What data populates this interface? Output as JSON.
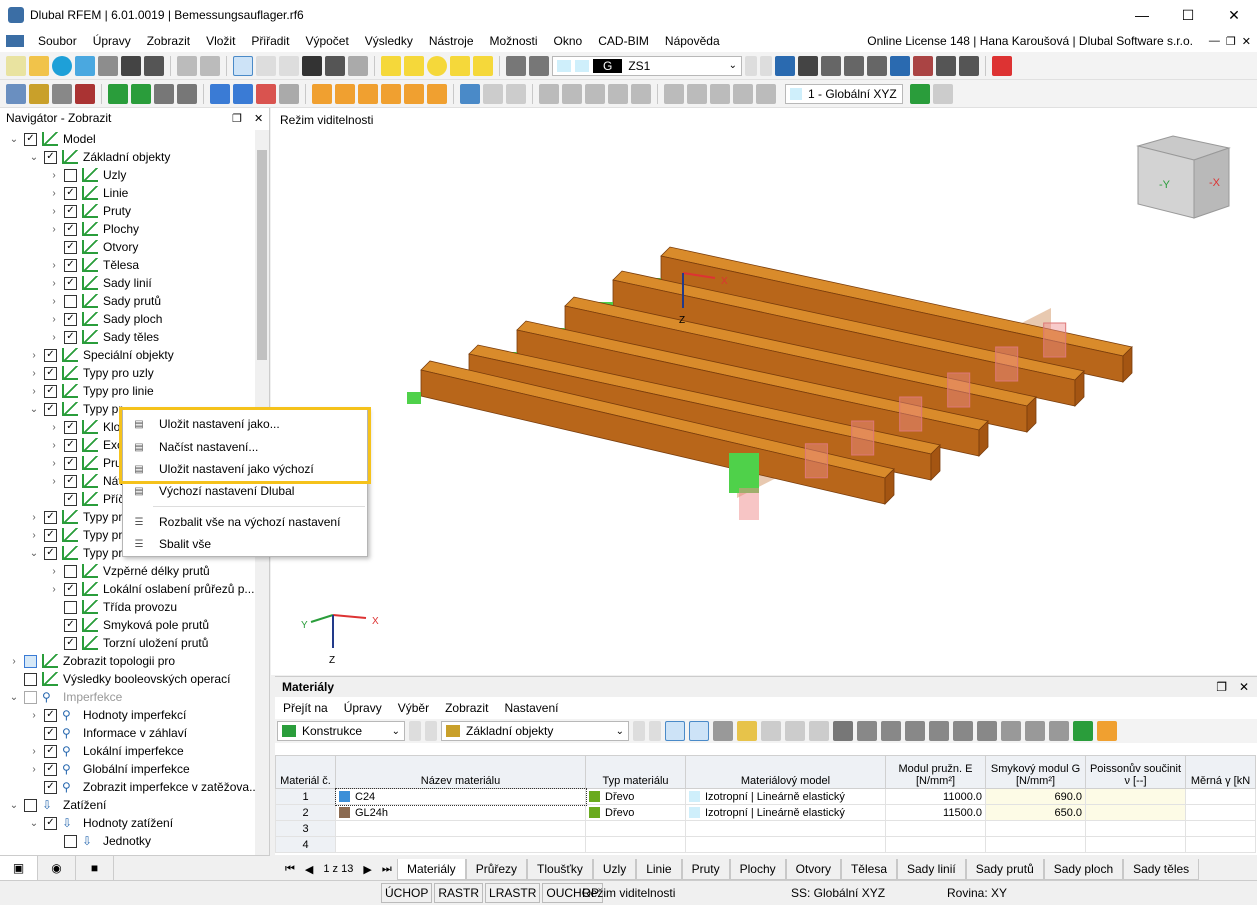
{
  "window": {
    "title": "Dlubal RFEM | 6.01.0019 | Bemessungsauflager.rf6",
    "minimize": "—",
    "maximize": "☐",
    "close": "✕"
  },
  "menu": {
    "items": [
      "Soubor",
      "Úpravy",
      "Zobrazit",
      "Vložit",
      "Přiřadit",
      "Výpočet",
      "Výsledky",
      "Nástroje",
      "Možnosti",
      "Okno",
      "CAD-BIM",
      "Nápověda"
    ],
    "license": "Online License 148 | Hana Karoušová | Dlubal Software s.r.o."
  },
  "toolbar": {
    "loadcase_code": "G",
    "loadcase": "ZS1",
    "coord_system": "1 - Globální XYZ"
  },
  "navigator": {
    "title": "Navigátor - Zobrazit",
    "items": [
      {
        "label": "Model",
        "level": 0,
        "exp": "⌄",
        "checked": true
      },
      {
        "label": "Základní objekty",
        "level": 1,
        "exp": "⌄",
        "checked": true
      },
      {
        "label": "Uzly",
        "level": 2,
        "exp": "›",
        "checked": false
      },
      {
        "label": "Linie",
        "level": 2,
        "exp": "›",
        "checked": true
      },
      {
        "label": "Pruty",
        "level": 2,
        "exp": "›",
        "checked": true
      },
      {
        "label": "Plochy",
        "level": 2,
        "exp": "›",
        "checked": true
      },
      {
        "label": "Otvory",
        "level": 2,
        "exp": "",
        "checked": true
      },
      {
        "label": "Tělesa",
        "level": 2,
        "exp": "›",
        "checked": true
      },
      {
        "label": "Sady linií",
        "level": 2,
        "exp": "›",
        "checked": true
      },
      {
        "label": "Sady prutů",
        "level": 2,
        "exp": "›",
        "checked": false
      },
      {
        "label": "Sady ploch",
        "level": 2,
        "exp": "›",
        "checked": true
      },
      {
        "label": "Sady těles",
        "level": 2,
        "exp": "›",
        "checked": true
      },
      {
        "label": "Speciální objekty",
        "level": 1,
        "exp": "›",
        "checked": true
      },
      {
        "label": "Typy pro uzly",
        "level": 1,
        "exp": "›",
        "checked": true
      },
      {
        "label": "Typy pro linie",
        "level": 1,
        "exp": "›",
        "checked": true
      },
      {
        "label": "Typy pr",
        "level": 1,
        "exp": "⌄",
        "checked": true
      },
      {
        "label": "Klo",
        "level": 2,
        "exp": "›",
        "checked": true
      },
      {
        "label": "Exc",
        "level": 2,
        "exp": "›",
        "checked": true
      },
      {
        "label": "Pru",
        "level": 2,
        "exp": "›",
        "checked": true
      },
      {
        "label": "Náv",
        "level": 2,
        "exp": "›",
        "checked": true
      },
      {
        "label": "Příč",
        "level": 2,
        "exp": "",
        "checked": true
      },
      {
        "label": "Typy pro",
        "level": 1,
        "exp": "›",
        "checked": true
      },
      {
        "label": "Typy pro",
        "level": 1,
        "exp": "›",
        "checked": true
      },
      {
        "label": "Typy pro",
        "level": 1,
        "exp": "⌄",
        "checked": true
      },
      {
        "label": "Vzpěrné délky prutů",
        "level": 2,
        "exp": "›",
        "checked": false
      },
      {
        "label": "Lokální oslabení průřezů p...",
        "level": 2,
        "exp": "›",
        "checked": true
      },
      {
        "label": "Třída provozu",
        "level": 2,
        "exp": "",
        "checked": false
      },
      {
        "label": "Smyková pole prutů",
        "level": 2,
        "exp": "",
        "checked": true
      },
      {
        "label": "Torzní uložení prutů",
        "level": 2,
        "exp": "",
        "checked": true
      },
      {
        "label": "Zobrazit topologii pro",
        "level": 0,
        "exp": "›",
        "checked": false
      },
      {
        "label": "Výsledky booleovských operací",
        "level": 0,
        "exp": "",
        "checked": false
      },
      {
        "label": "Imperfekce",
        "level": 0,
        "exp": "⌄",
        "checked": false,
        "grey": true
      },
      {
        "label": "Hodnoty imperfekcí",
        "level": 1,
        "exp": "›",
        "checked": true
      },
      {
        "label": "Informace v záhlaví",
        "level": 1,
        "exp": "",
        "checked": true
      },
      {
        "label": "Lokální imperfekce",
        "level": 1,
        "exp": "›",
        "checked": true
      },
      {
        "label": "Globální imperfekce",
        "level": 1,
        "exp": "›",
        "checked": true
      },
      {
        "label": "Zobrazit imperfekce v zatěžova...",
        "level": 1,
        "exp": "",
        "checked": true
      },
      {
        "label": "Zatížení",
        "level": 0,
        "exp": "⌄",
        "checked": false
      },
      {
        "label": "Hodnoty zatížení",
        "level": 1,
        "exp": "⌄",
        "checked": true
      },
      {
        "label": "Jednotky",
        "level": 2,
        "exp": "",
        "checked": false
      }
    ]
  },
  "context_menu": {
    "items": [
      "Uložit nastavení jako...",
      "Načíst nastavení...",
      "Uložit nastavení jako výchozí",
      "Výchozí nastavení Dlubal",
      "Rozbalit vše na výchozí nastavení",
      "Sbalit vše"
    ]
  },
  "viewport": {
    "mode_label": "Režim viditelnosti",
    "axis_x": "X",
    "axis_y": "Y",
    "axis_z": "Z",
    "cube_y": "-Y",
    "cube_x": "-X"
  },
  "materials": {
    "title": "Materiály",
    "menu": [
      "Přejít na",
      "Úpravy",
      "Výběr",
      "Zobrazit",
      "Nastavení"
    ],
    "filter1": "Konstrukce",
    "filter2": "Základní objekty",
    "columns": [
      "Materiál č.",
      "Název materiálu",
      "Typ materiálu",
      "Materiálový model",
      "Modul pružn. E [N/mm²]",
      "Smykový modul G [N/mm²]",
      "Poissonův součinit ν [--]",
      "Měrná γ [kN"
    ],
    "rows": [
      {
        "no": "1",
        "name": "C24",
        "name_color": "#3b8fd8",
        "type": "Dřevo",
        "type_color": "#6aaa1e",
        "model": "Izotropní | Lineárně elastický",
        "model_color": "#cfeffb",
        "E": "11000.0",
        "G": "690.0",
        "nu": "",
        "gamma": ""
      },
      {
        "no": "2",
        "name": "GL24h",
        "name_color": "#8b6a50",
        "type": "Dřevo",
        "type_color": "#6aaa1e",
        "model": "Izotropní | Lineárně elastický",
        "model_color": "#cfeffb",
        "E": "11500.0",
        "G": "650.0",
        "nu": "",
        "gamma": ""
      },
      {
        "no": "3",
        "name": "",
        "type": "",
        "model": "",
        "E": "",
        "G": "",
        "nu": "",
        "gamma": ""
      },
      {
        "no": "4",
        "name": "",
        "type": "",
        "model": "",
        "E": "",
        "G": "",
        "nu": "",
        "gamma": ""
      }
    ],
    "pager": "1 z 13",
    "tabs": [
      "Materiály",
      "Průřezy",
      "Tloušťky",
      "Uzly",
      "Linie",
      "Pruty",
      "Plochy",
      "Otvory",
      "Tělesa",
      "Sady linií",
      "Sady prutů",
      "Sady ploch",
      "Sady těles"
    ]
  },
  "status": {
    "toggles": [
      "ÚCHOP",
      "RASTR",
      "LRASTR",
      "OUCHOP"
    ],
    "mode": "Režim viditelnosti",
    "cs": "SS: Globální XYZ",
    "plane": "Rovina: XY"
  }
}
